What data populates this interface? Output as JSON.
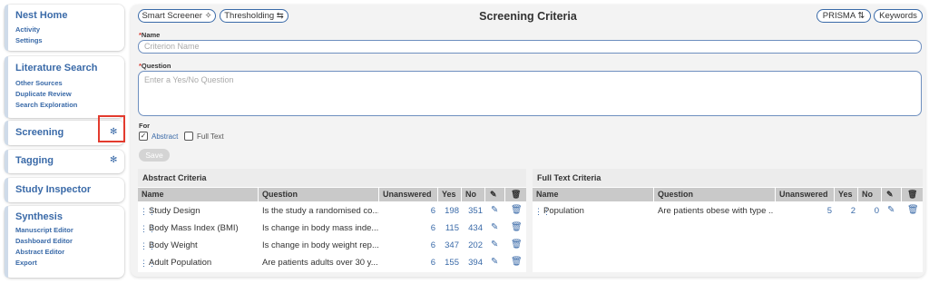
{
  "sidebar": {
    "nest_home": {
      "title": "Nest Home",
      "items": [
        "Activity",
        "Settings"
      ]
    },
    "literature_search": {
      "title": "Literature Search",
      "items": [
        "Other Sources",
        "Duplicate Review",
        "Search Exploration"
      ]
    },
    "screening": {
      "title": "Screening"
    },
    "tagging": {
      "title": "Tagging"
    },
    "study_inspector": {
      "title": "Study Inspector"
    },
    "synthesis": {
      "title": "Synthesis",
      "items": [
        "Manuscript Editor",
        "Dashboard Editor",
        "Abstract Editor",
        "Export"
      ]
    }
  },
  "header": {
    "smart_screener": "Smart Screener ✧",
    "thresholding": "Thresholding ⇆",
    "title": "Screening Criteria",
    "prisma": "PRISMA ⇅",
    "keywords": "Keywords"
  },
  "form": {
    "name_label": "Name",
    "name_placeholder": "Criterion Name",
    "question_label": "Question",
    "question_placeholder": "Enter a Yes/No Question",
    "for_label": "For",
    "abstract_label": "Abstract",
    "abstract_checked": true,
    "fulltext_label": "Full Text",
    "fulltext_checked": false,
    "save_label": "Save"
  },
  "abstract_table": {
    "title": "Abstract Criteria",
    "columns": [
      "Name",
      "Question",
      "Unanswered",
      "Yes",
      "No"
    ],
    "rows": [
      {
        "name": "Study Design",
        "question": "Is the study a randomised co...",
        "unanswered": "6",
        "yes": "198",
        "no": "351"
      },
      {
        "name": "Body Mass Index (BMI)",
        "question": "Is change in body mass inde...",
        "unanswered": "6",
        "yes": "115",
        "no": "434"
      },
      {
        "name": "Body Weight",
        "question": "Is change in body weight rep...",
        "unanswered": "6",
        "yes": "347",
        "no": "202"
      },
      {
        "name": "Adult Population",
        "question": "Are patients adults over 30 y...",
        "unanswered": "6",
        "yes": "155",
        "no": "394"
      }
    ]
  },
  "fulltext_table": {
    "title": "Full Text Criteria",
    "columns": [
      "Name",
      "Question",
      "Unanswered",
      "Yes",
      "No"
    ],
    "rows": [
      {
        "name": "Population",
        "question": "Are patients obese with type ...",
        "unanswered": "5",
        "yes": "2",
        "no": "0"
      }
    ]
  },
  "colors": {
    "accent": "#3a6aa8",
    "highlight_box": "#e33b2e",
    "header_row": "#c9c9c9"
  }
}
